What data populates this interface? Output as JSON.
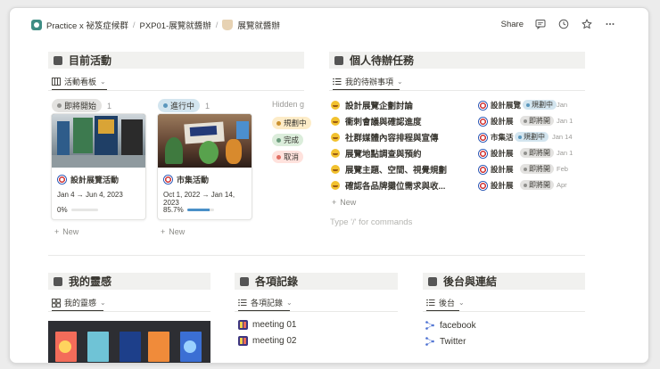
{
  "breadcrumb": {
    "workspace": "Practice x 祕笈症候群",
    "parent": "PXP01-展覽就醬辦",
    "page": "展覽就醬辦"
  },
  "topbar": {
    "share_label": "Share"
  },
  "current_activity": {
    "title": "目前活動",
    "view_tab": "活動看板",
    "columns": [
      {
        "status": "即將開始",
        "count": "1",
        "card": {
          "title": "設計展覽活動",
          "dates": "Jan 4 → Jun 4, 2023",
          "progress_label": "0%",
          "progress": 0.0
        }
      },
      {
        "status": "進行中",
        "count": "1",
        "card": {
          "title": "市集活動",
          "dates": "Oct 1, 2022 → Jan 14, 2023",
          "progress_label": "85.7%",
          "progress": 0.857
        }
      }
    ],
    "hidden_label": "Hidden g",
    "hidden_groups": [
      "規劃中",
      "完成",
      "取消"
    ],
    "new_label": "New"
  },
  "personal_tasks": {
    "title": "個人待辦任務",
    "view_tab": "我的待辦事項",
    "tasks": [
      {
        "name": "設計展覽企劃討論",
        "ref": "設計展覽",
        "status": "規劃中",
        "date": "Jan"
      },
      {
        "name": "衝刺會議與確認進度",
        "ref": "設計展",
        "status": "即將開",
        "date": "Jan 1"
      },
      {
        "name": "社群媒體內容排程與宣傳",
        "ref": "市集活",
        "status": "規劃中",
        "date": "Jan 14"
      },
      {
        "name": "展覽地點調查與預約",
        "ref": "設計展",
        "status": "即將開",
        "date": "Jan 1"
      },
      {
        "name": "展覽主題、空間、視覺規劃",
        "ref": "設計展",
        "status": "即將開",
        "date": "Feb"
      },
      {
        "name": "確認各品牌攤位需求與收...",
        "ref": "設計展",
        "status": "即將開",
        "date": "Apr"
      }
    ],
    "new_label": "New",
    "command_placeholder": "Type '/' for commands"
  },
  "inspiration": {
    "title": "我的靈感",
    "view_tab": "我的靈感"
  },
  "records": {
    "title": "各項記錄",
    "view_tab": "各項記錄",
    "items": [
      "meeting 01",
      "meeting 02"
    ]
  },
  "backstage": {
    "title": "後台與連結",
    "view_tab": "後台",
    "links": [
      "facebook",
      "Twitter"
    ]
  },
  "colors": {
    "upcoming": "#e3e2e0",
    "in_progress": "#d3e5ef",
    "planning": "#fdecc8",
    "done": "#dbeddb",
    "cancelled": "#ffe2dd",
    "progress_fill": "#4a90c8"
  }
}
